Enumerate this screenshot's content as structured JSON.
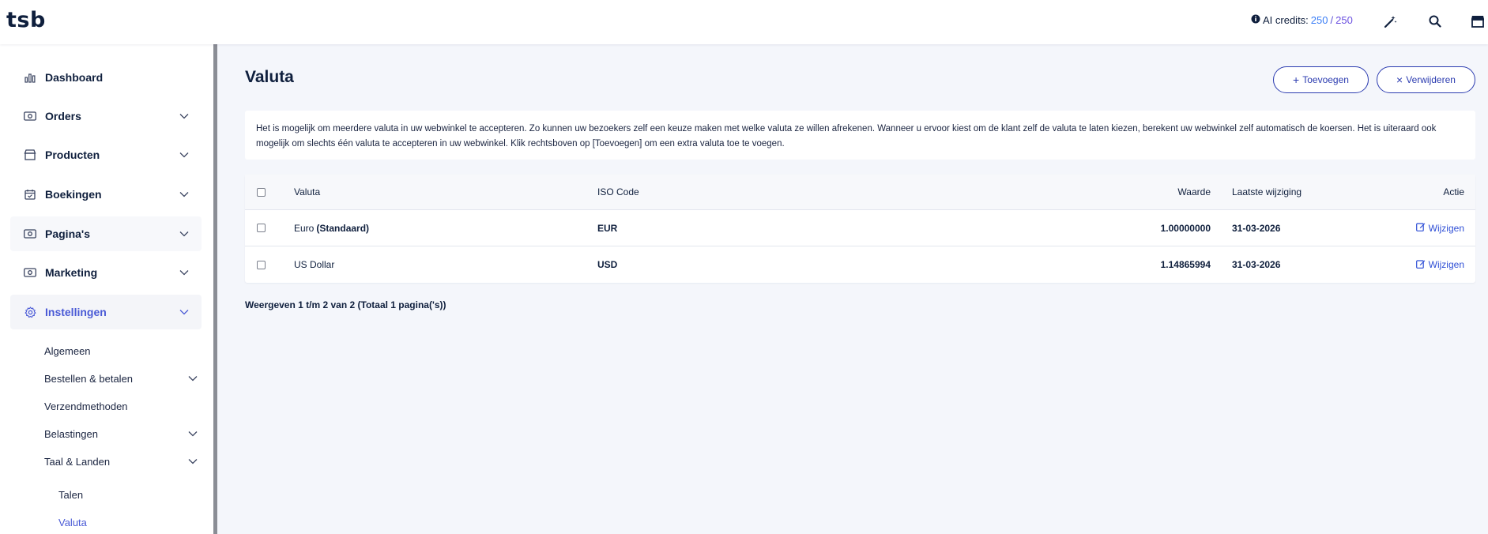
{
  "header": {
    "logo": "tsb",
    "credits_label": "AI credits:",
    "credits_used": "250",
    "credits_sep": "/",
    "credits_total": "250",
    "icons": [
      "info-circle-icon",
      "magic-wand-icon",
      "search-icon",
      "store-icon"
    ]
  },
  "sidebar": {
    "items": [
      {
        "label": "Dashboard",
        "icon": "bar-chart-icon",
        "has_children": false
      },
      {
        "label": "Orders",
        "icon": "money-icon",
        "has_children": true
      },
      {
        "label": "Producten",
        "icon": "shop-icon",
        "has_children": true
      },
      {
        "label": "Boekingen",
        "icon": "calendar-icon",
        "has_children": true
      },
      {
        "label": "Pagina's",
        "icon": "money-icon",
        "has_children": true
      },
      {
        "label": "Marketing",
        "icon": "money-icon",
        "has_children": true
      },
      {
        "label": "Instellingen",
        "icon": "gear-icon",
        "has_children": true,
        "active": true
      }
    ],
    "sub_items": [
      {
        "label": "Algemeen",
        "has_children": false
      },
      {
        "label": "Bestellen & betalen",
        "has_children": true
      },
      {
        "label": "Verzendmethoden",
        "has_children": false
      },
      {
        "label": "Belastingen",
        "has_children": true
      },
      {
        "label": "Taal & Landen",
        "has_children": true
      }
    ],
    "sub_sub_items": [
      {
        "label": "Talen",
        "active": false
      },
      {
        "label": "Valuta",
        "active": true
      }
    ]
  },
  "main": {
    "title": "Valuta",
    "add_button": "Toevoegen",
    "delete_button": "Verwijderen",
    "info_text": "Het is mogelijk om meerdere valuta in uw webwinkel te accepteren. Zo kunnen uw bezoekers zelf een keuze maken met welke valuta ze willen afrekenen. Wanneer u ervoor kiest om de klant zelf de valuta te laten kiezen, berekent uw webwinkel zelf automatisch de koersen. Het is uiteraard ook mogelijk om slechts één valuta te accepteren in uw webwinkel. Klik rechtsboven op [Toevoegen] om een extra valuta toe te voegen.",
    "table": {
      "headers": {
        "currency": "Valuta",
        "iso": "ISO Code",
        "value": "Waarde",
        "modified": "Laatste wijziging",
        "action": "Actie"
      },
      "rows": [
        {
          "name": "Euro",
          "tag": "(Standaard)",
          "iso": "EUR",
          "value": "1.00000000",
          "modified": "31-03-2026",
          "action": "Wijzigen"
        },
        {
          "name": "US Dollar",
          "tag": "",
          "iso": "USD",
          "value": "1.14865994",
          "modified": "31-03-2026",
          "action": "Wijzigen"
        }
      ]
    },
    "pagination": "Weergeven 1 t/m 2 van 2 (Totaal 1 pagina('s))"
  },
  "colors": {
    "accent": "#2c3cb0",
    "active_nav": "#4a5ad6",
    "credits_blue": "#3b7ef6",
    "credits_purple": "#6a4fe0"
  }
}
